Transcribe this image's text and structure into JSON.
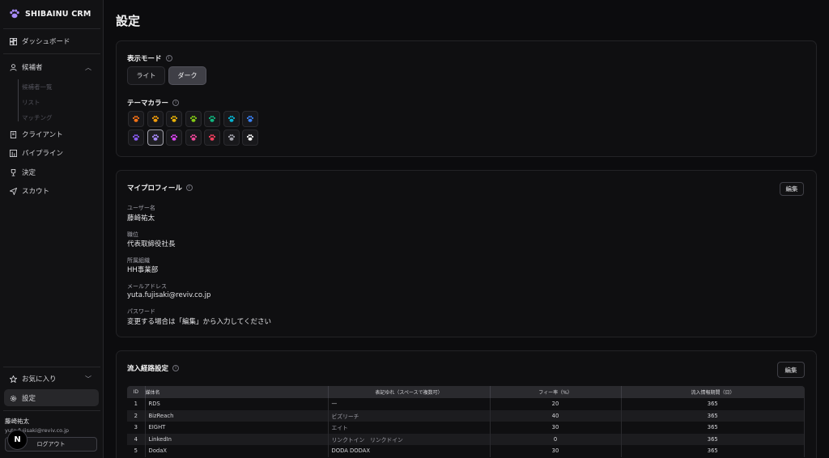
{
  "app": {
    "brand": "SHIBAINU CRM"
  },
  "sidebar": {
    "items": [
      {
        "label": "ダッシュボード",
        "icon": "dashboard-icon"
      },
      {
        "label": "候補者",
        "icon": "user-icon"
      },
      {
        "label": "クライアント",
        "icon": "building-icon"
      },
      {
        "label": "パイプライン",
        "icon": "chart-bar-icon"
      },
      {
        "label": "決定",
        "icon": "trophy-icon"
      },
      {
        "label": "スカウト",
        "icon": "send-icon"
      }
    ],
    "candidate_sub": [
      "候補者一覧",
      "リスト",
      "マッチング"
    ],
    "favorites": "お気に入り",
    "settings": "設定",
    "user_name": "藤崎祐太",
    "user_email": "yuta.fujisaki@reviv.co.jp",
    "logout": "ログアウト",
    "badge": "N"
  },
  "page": {
    "title": "設定"
  },
  "display": {
    "title": "表示モード",
    "modes": [
      "ライト",
      "ダーク"
    ],
    "selected_mode": "ダーク",
    "theme_title": "テーマカラー",
    "theme_colors": [
      "#f97316",
      "#f59e0b",
      "#eab308",
      "#84cc16",
      "#10b981",
      "#06b6d4",
      "#3b82f6",
      "#8b5cf6",
      "#a78bfa",
      "#d946ef",
      "#ec4899",
      "#f43f5e",
      "#a1a1aa",
      "#f5f5f5"
    ],
    "selected_color": "#a78bfa"
  },
  "profile": {
    "title": "マイプロフィール",
    "edit": "編集",
    "fields": [
      {
        "label": "ユーザー名",
        "value": "藤崎祐太"
      },
      {
        "label": "職位",
        "value": "代表取締役社長"
      },
      {
        "label": "所属組織",
        "value": "HH事業部"
      },
      {
        "label": "メールアドレス",
        "value": "yuta.fujisaki@reviv.co.jp"
      },
      {
        "label": "パスワード",
        "value": "変更する場合は「編集」から入力してください"
      }
    ]
  },
  "inflow": {
    "title": "流入経路設定",
    "edit": "編集",
    "columns": [
      "ID",
      "媒体名",
      "表記ゆれ（スペースで複数可）",
      "フィー率（%）",
      "流入情報期間（日）"
    ],
    "rows": [
      {
        "id": "1",
        "name": "RDS",
        "alias": "—",
        "fee": "20",
        "days": "365"
      },
      {
        "id": "2",
        "name": "BizReach",
        "alias": "ビズリーチ",
        "fee": "40",
        "days": "365"
      },
      {
        "id": "3",
        "name": "EIGHT",
        "alias": "エイト",
        "fee": "30",
        "days": "365"
      },
      {
        "id": "4",
        "name": "LinkedIn",
        "alias": "リンクトイン　リンクドイン",
        "fee": "0",
        "days": "365"
      },
      {
        "id": "5",
        "name": "DodaX",
        "alias": "DODA DODAX",
        "fee": "30",
        "days": "365"
      }
    ]
  }
}
